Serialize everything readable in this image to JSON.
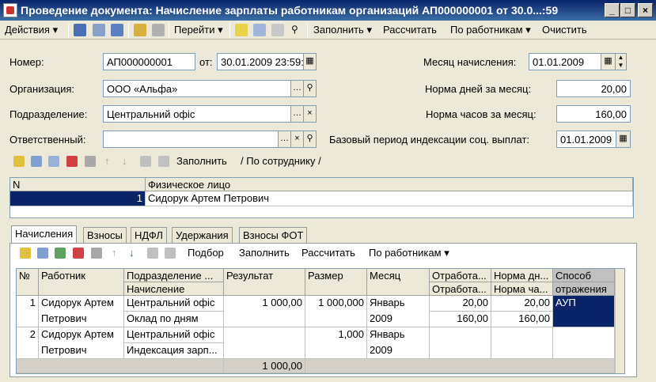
{
  "window": {
    "title": "Проведение документа: Начисление зарплаты работникам организаций АП000000001 от 30.0...:59"
  },
  "toolbar": {
    "actions": "Действия",
    "goto": "Перейти",
    "fill": "Заполнить",
    "calculate": "Рассчитать",
    "by_employees": "По работникам",
    "clear": "Очистить",
    "icons": [
      "arrow-left-icon",
      "document-icon",
      "refresh-icon",
      "lock-icon",
      "copy-icon",
      "help-icon",
      "list-icon",
      "find-icon",
      "search-icon"
    ]
  },
  "form": {
    "number_label": "Номер:",
    "number_value": "АП000000001",
    "date_label": "от:",
    "date_value": "30.01.2009 23:59:59",
    "month_label": "Месяц начисления:",
    "month_value": "01.01.2009",
    "org_label": "Организация:",
    "org_value": "ООО «Альфа»",
    "days_label": "Норма дней за месяц:",
    "days_value": "20,00",
    "dept_label": "Подразделение:",
    "dept_value": "Центральний офіс",
    "hours_label": "Норма часов за месяц:",
    "hours_value": "160,00",
    "resp_label": "Ответственный:",
    "resp_value": "",
    "base_label": "Базовый период индексации соц. выплат:",
    "base_value": "01.01.2009"
  },
  "persons": {
    "fill_label": "Заполнить",
    "by_employee_label": "/ По сотруднику /",
    "col_n": "N",
    "col_person": "Физическое лицо",
    "rows": [
      {
        "n": "1",
        "person": "Сидорук Артем Петрович"
      }
    ]
  },
  "tabs": [
    "Начисления",
    "Взносы",
    "НДФЛ",
    "Удержания",
    "Взносы ФОТ"
  ],
  "accruals_toolbar": {
    "select": "Подбор",
    "fill": "Заполнить",
    "calculate": "Рассчитать",
    "by_employees": "По работникам"
  },
  "accruals": {
    "headers": {
      "n": "№",
      "worker": "Работник",
      "dept": "Подразделение ...",
      "accrual": "Начисление",
      "result": "Результат",
      "size": "Размер",
      "month": "Месяц",
      "worked1": "Отработа...",
      "worked2": "Отработа...",
      "norm1": "Норма дн...",
      "norm2": "Норма ча...",
      "method1": "Способ",
      "method2": "отражения"
    },
    "rows": [
      {
        "n": "1",
        "worker1": "Сидорук Артем",
        "worker2": "Петрович",
        "dept": "Центральний офіс",
        "accrual": "Оклад по дням",
        "result": "1 000,00",
        "size": "1 000,000",
        "month1": "Январь",
        "month2": "2009",
        "worked_days": "20,00",
        "worked_hours": "160,00",
        "norm_days": "20,00",
        "norm_hours": "160,00",
        "method": "АУП"
      },
      {
        "n": "2",
        "worker1": "Сидорук Артем",
        "worker2": "Петрович",
        "dept": "Центральний офіс",
        "accrual": "Индексация зарп...",
        "result": "",
        "size": "1,000",
        "month1": "Январь",
        "month2": "2009",
        "worked_days": "",
        "worked_hours": "",
        "norm_days": "",
        "norm_hours": "",
        "method": ""
      }
    ],
    "total_result": "1 000,00"
  },
  "colors": {
    "selection": "#0a246a",
    "title_bar": "#0a246a"
  }
}
